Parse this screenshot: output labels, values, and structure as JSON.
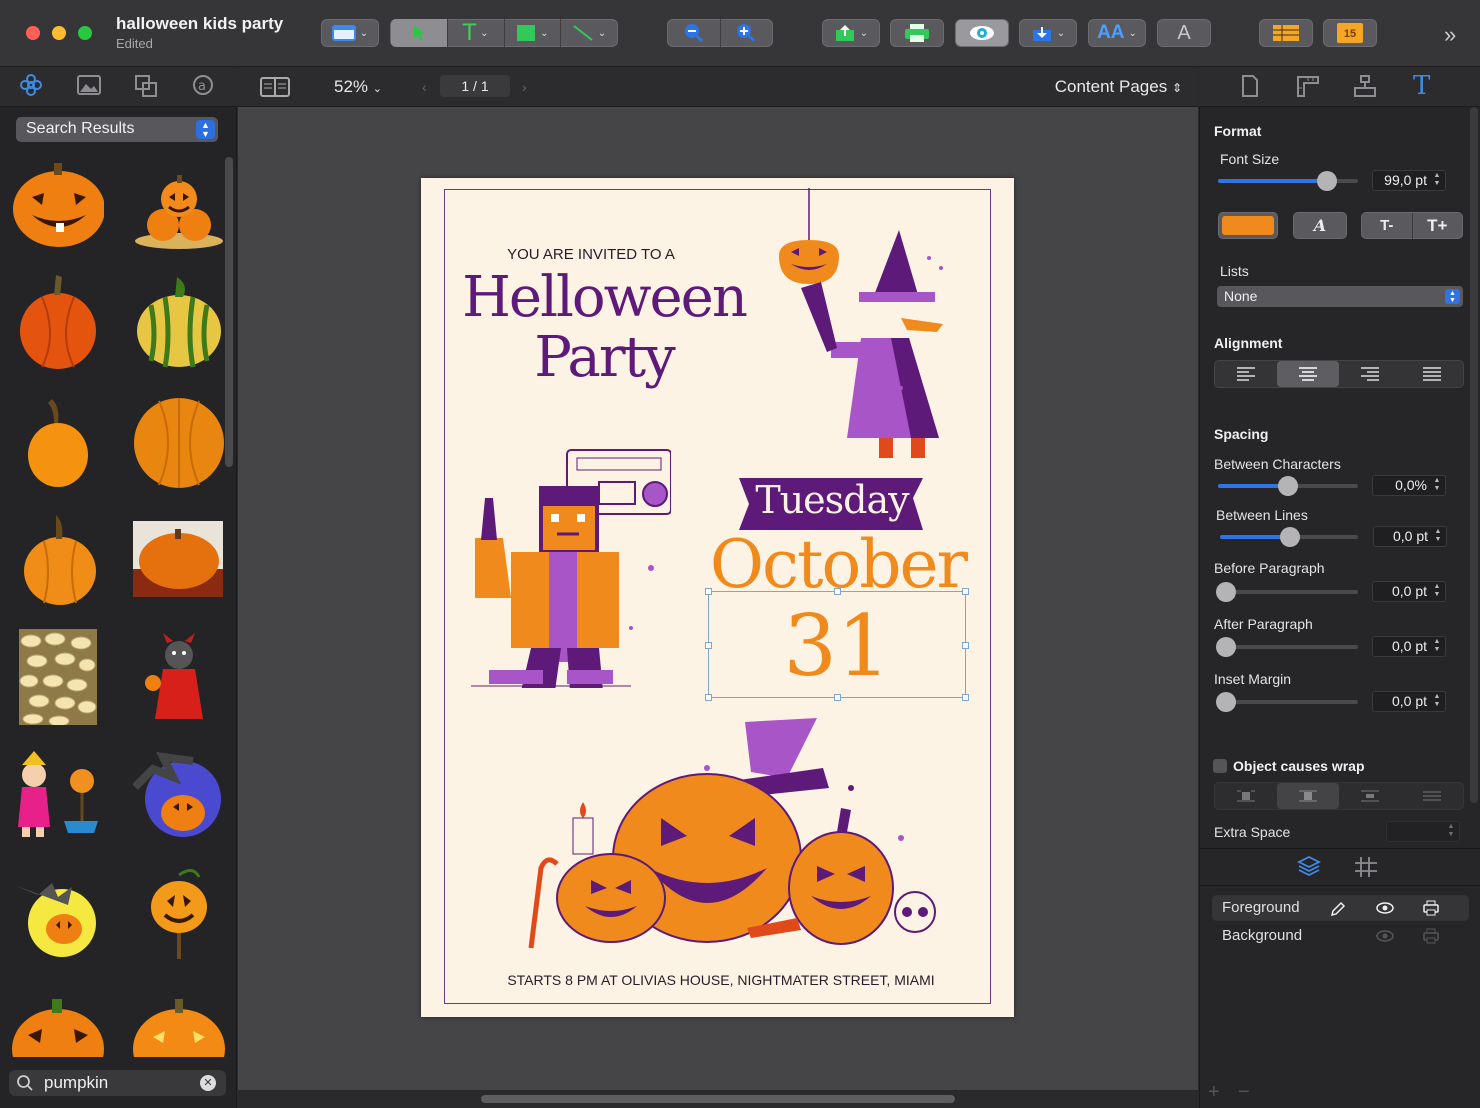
{
  "window": {
    "title": "halloween kids party",
    "subtitle": "Edited"
  },
  "toolbar": {
    "calendar_badge": "15"
  },
  "subbar": {
    "zoom": "52%",
    "page_indicator": "1 / 1",
    "content_pages": "Content Pages"
  },
  "library": {
    "source_popup": "Search Results",
    "search_value": "pumpkin"
  },
  "document": {
    "invited_line": "YOU ARE INVITED TO A",
    "title_line1": "Helloween",
    "title_line2": "Party",
    "day": "Tuesday",
    "month": "October",
    "date": "31",
    "footer": "STARTS 8 PM AT OLIVIAS HOUSE, NIGHTMATER STREET, MIAMI"
  },
  "inspector": {
    "format_title": "Format",
    "font_size_label": "Font Size",
    "font_size_value": "99,0 pt",
    "font_size_level": 0.78,
    "font_color": "#f08a1c",
    "italic_label": "A",
    "shrink_label": "T-",
    "grow_label": "T+",
    "lists_label": "Lists",
    "lists_value": "None",
    "alignment_title": "Alignment",
    "spacing_title": "Spacing",
    "between_chars_label": "Between Characters",
    "between_chars_value": "0,0%",
    "between_lines_label": "Between Lines",
    "between_lines_value": "0,0 pt",
    "before_para_label": "Before Paragraph",
    "before_para_value": "0,0 pt",
    "after_para_label": "After Paragraph",
    "after_para_value": "0,0 pt",
    "inset_label": "Inset Margin",
    "inset_value": "0,0 pt",
    "wrap_label": "Object causes wrap",
    "extra_space_label": "Extra Space",
    "extra_space_value": ""
  },
  "layers": {
    "items": [
      {
        "name": "Foreground"
      },
      {
        "name": "Background"
      }
    ]
  },
  "colors": {
    "accent": "#2d74e6",
    "orange": "#f08a1c",
    "purple": "#5e1a78",
    "paper": "#fdf3e4"
  }
}
